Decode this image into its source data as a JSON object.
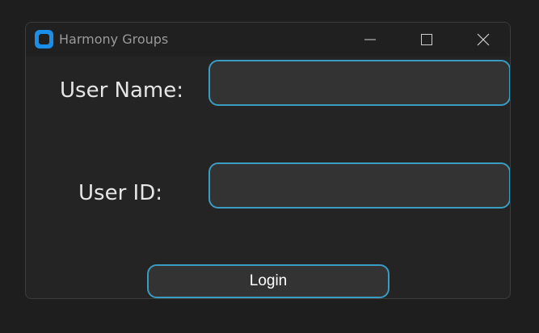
{
  "window": {
    "title": "Harmony Groups",
    "app_icon": "app-logo-icon",
    "controls": {
      "minimize": "minimize-icon",
      "maximize": "maximize-icon",
      "close": "close-icon"
    }
  },
  "form": {
    "username_label": "User Name:",
    "username_value": "",
    "userid_label": "User ID:",
    "userid_value": "",
    "login_label": "Login"
  },
  "colors": {
    "accent_border": "#3a9cc0",
    "window_bg": "#242424",
    "field_bg": "#333333",
    "app_icon": "#1a8ee8"
  }
}
